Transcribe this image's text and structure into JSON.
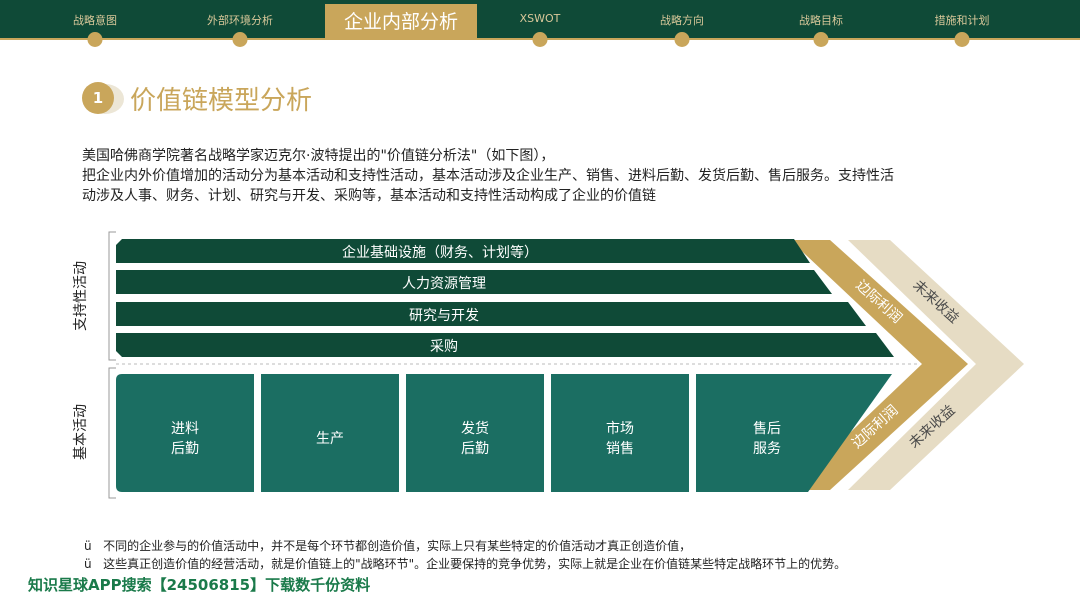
{
  "nav": {
    "items": [
      "战略意图",
      "外部环境分析",
      "企业内部分析",
      "XSWOT",
      "战略方向",
      "战略目标",
      "措施和计划"
    ],
    "active": "企业内部分析"
  },
  "section": {
    "number": "1",
    "title": "价值链模型分析"
  },
  "intro": [
    "美国哈佛商学院著名战略学家迈克尔·波特提出的\"价值链分析法\"（如下图），",
    "把企业内外价值增加的活动分为基本活动和支持性活动，基本活动涉及企业生产、销售、进料后勤、发货后勤、售后服务。支持性活",
    "动涉及人事、财务、计划、研究与开发、采购等，基本活动和支持性活动构成了企业的价值链"
  ],
  "diagram": {
    "support_label": "支持性活动",
    "primary_label": "基本活动",
    "support_activities": [
      "企业基础设施（财务、计划等）",
      "人力资源管理",
      "研究与开发",
      "采购"
    ],
    "primary_activities": [
      [
        "进料",
        "后勤"
      ],
      [
        "生产"
      ],
      [
        "发货",
        "后勤"
      ],
      [
        "市场",
        "销售"
      ],
      [
        "售后",
        "服务"
      ]
    ],
    "margin_label": "边际利润",
    "future_label": "未来收益",
    "colors": {
      "dark": "#0f4a37",
      "teal": "#1b6e62",
      "gold": "#c9a65b",
      "beige": "#e6dcc4"
    }
  },
  "notes": {
    "bullet": "ü",
    "lines": [
      "不同的企业参与的价值活动中，并不是每个环节都创造价值，实际上只有某些特定的价值活动才真正创造价值，",
      "这些真正创造价值的经营活动，就是价值链上的\"战略环节\"。企业要保持的竞争优势，实际上就是企业在价值链某些特定战略环节上的优势。"
    ]
  },
  "footer": "知识星球APP搜索【24506815】下载数千份资料"
}
